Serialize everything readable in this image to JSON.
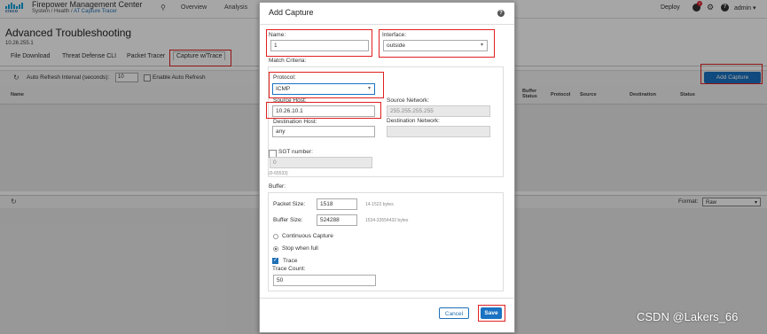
{
  "header": {
    "brand": "cisco",
    "app_title": "Firepower Management Center",
    "breadcrumb_prefix": "System / Health / ",
    "breadcrumb_current": "AT Capture Tracer",
    "nav": [
      "Overview",
      "Analysis"
    ],
    "deploy_label": "Deploy",
    "notification_badge": "2",
    "user": "admin"
  },
  "page": {
    "title": "Advanced Troubleshooting",
    "device_ip": "10.26.255.1",
    "tabs": [
      "File Download",
      "Threat Defense CLI",
      "Packet Tracer",
      "Capture w/Trace"
    ],
    "active_tab": "Capture w/Trace"
  },
  "toolbar": {
    "auto_refresh_label": "Auto Refresh Interval (seconds):",
    "auto_refresh_value": "10",
    "enable_auto_refresh_label": "Enable Auto Refresh",
    "add_capture_label": "Add Capture"
  },
  "table": {
    "columns": [
      "Name",
      "Buffer Status",
      "Protocol",
      "Source",
      "Destination",
      "Status"
    ]
  },
  "lower_pane": {
    "format_label": "Format:",
    "format_value": "Raw"
  },
  "modal": {
    "title": "Add Capture",
    "name_label": "Name:",
    "name_value": "1",
    "interface_label": "Interface:",
    "interface_value": "outside",
    "match_criteria_label": "Match Criteria:",
    "protocol_label": "Protocol:",
    "protocol_value": "ICMP",
    "source_host_label": "Source Host:",
    "source_host_value": "10.26.10.1",
    "source_network_label": "Source Network:",
    "source_network_placeholder": "255.255.255.255",
    "dest_host_label": "Destination Host:",
    "dest_host_value": "any",
    "dest_network_label": "Destination Network:",
    "sgt_label": "SGT number:",
    "sgt_value": "0",
    "sgt_hint": "(0-65533)",
    "buffer_label": "Buffer:",
    "packet_size_label": "Packet Size:",
    "packet_size_value": "1518",
    "packet_size_hint": "14-1522 bytes",
    "buffer_size_label": "Buffer Size:",
    "buffer_size_value": "524288",
    "buffer_size_hint": "1534-33554432 bytes",
    "continuous_capture_label": "Continuous Capture",
    "stop_when_full_label": "Stop when full",
    "trace_label": "Trace",
    "trace_count_label": "Trace Count:",
    "trace_count_value": "50",
    "cancel_label": "Cancel",
    "save_label": "Save"
  },
  "watermark": "CSDN @Lakers_66"
}
